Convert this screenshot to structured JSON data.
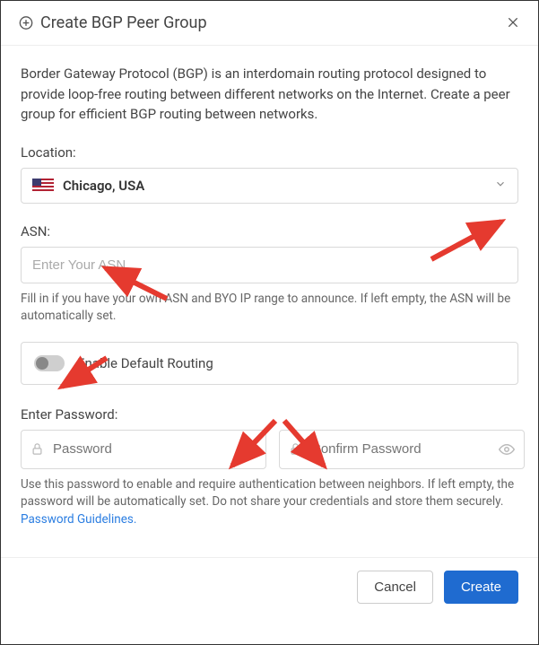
{
  "header": {
    "title": "Create BGP Peer Group"
  },
  "intro": "Border Gateway Protocol (BGP) is an interdomain routing protocol designed to provide loop-free routing between different networks on the Internet. Create a peer group for efficient BGP routing between networks.",
  "location": {
    "label": "Location:",
    "value": "Chicago, USA"
  },
  "asn": {
    "label": "ASN:",
    "placeholder": "Enter Your ASN",
    "helper": "Fill in if you have your own ASN and BYO IP range to announce. If left empty, the ASN will be automatically set."
  },
  "routing": {
    "label": "Enable Default Routing",
    "enabled": false
  },
  "password": {
    "label": "Enter Password:",
    "placeholder": "Password",
    "confirm_placeholder": "Confirm Password",
    "helper": "Use this password to enable and require authentication between neighbors. If left empty, the password will be automatically set. Do not share your credentials and store them securely.",
    "guidelines_link": "Password Guidelines."
  },
  "footer": {
    "cancel": "Cancel",
    "create": "Create"
  },
  "colors": {
    "primary": "#1f6bd0",
    "arrow": "#e53a2f"
  }
}
